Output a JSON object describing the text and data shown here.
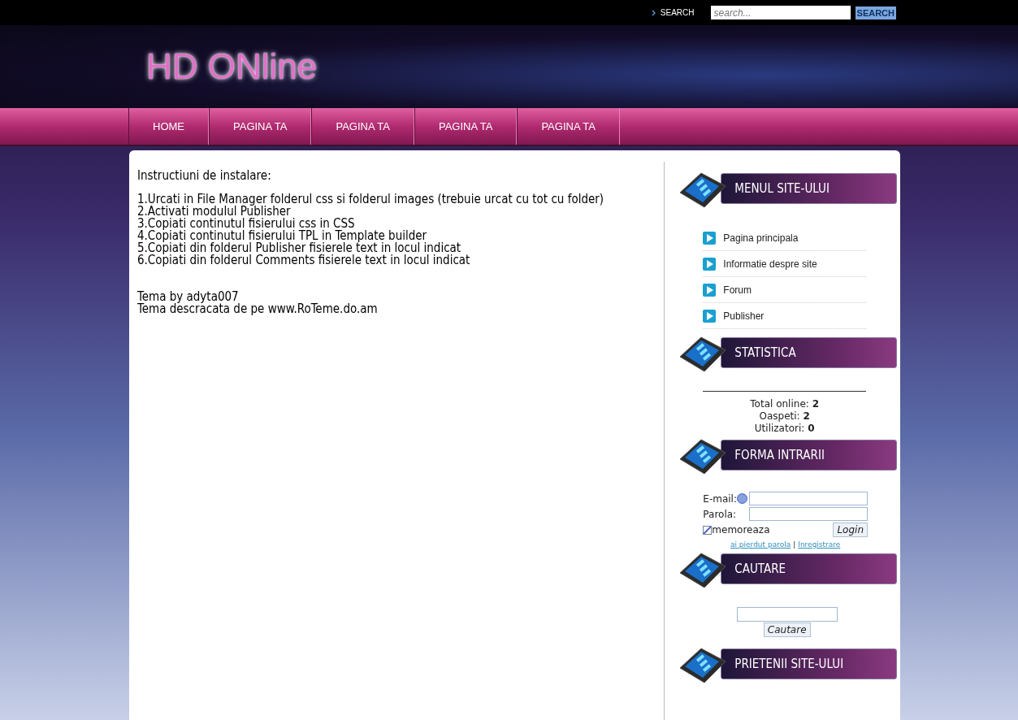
{
  "top_bar": {
    "search_label": "SEARCH",
    "search": {
      "placeholder": "search..."
    },
    "search_button": "SEARCH"
  },
  "header": {
    "logo": "HD ONline"
  },
  "nav": [
    {
      "label": "HOME"
    },
    {
      "label": "PAGINA TA"
    },
    {
      "label": "PAGINA TA"
    },
    {
      "label": "PAGINA TA"
    },
    {
      "label": "PAGINA TA"
    }
  ],
  "content": {
    "title": "Instructiuni de instalare:",
    "steps": [
      "1.Urcati in File Manager folderul css si folderul images (trebuie urcat cu tot cu folder)",
      "2.Activati modulul Publisher",
      "3.Copiati continutul fisierului css in CSS",
      "4.Copiati continutul fisierului TPL in Template builder",
      "5.Copiati din folderul Publisher fisierele text in locul indicat",
      "6.Copiati din folderul Comments fisierele text in locul indicat"
    ],
    "credits": [
      "Tema by adyta007",
      "Tema descracata de pe www.RoTeme.do.am"
    ]
  },
  "sidebar": [
    {
      "kind": "menu",
      "title": "MENUL SITE-ULUI",
      "items": [
        "Pagina principala",
        "Informatie despre site",
        "Forum",
        "Publisher"
      ]
    },
    {
      "kind": "stats",
      "title": "STATISTICA",
      "lines": [
        "Total online: **2**",
        "Oaspeti: **2**",
        "Utilizatori: **0**"
      ]
    },
    {
      "kind": "login",
      "title": "FORMA INTRARII",
      "email_label": "E-mail:",
      "password_label": "Parola:",
      "remember": {
        "label": "memoreaza",
        "checked": true
      },
      "login_button": "Login",
      "links": [
        "ai pierdut parola",
        "Inregistrare"
      ],
      "link_separator": "|"
    },
    {
      "kind": "search",
      "title": "CAUTARE",
      "button": "Cautare"
    },
    {
      "kind": "friends",
      "title": "PRIETENII SITE-ULUI"
    }
  ]
}
